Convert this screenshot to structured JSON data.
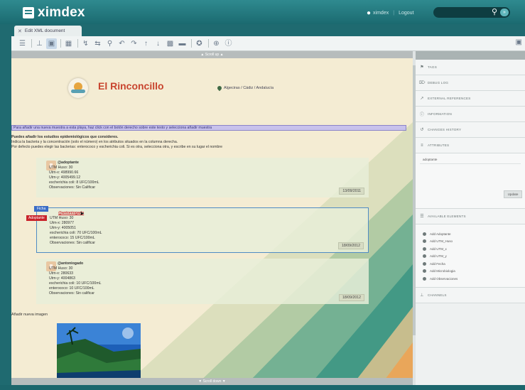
{
  "app": {
    "logo_text": "ximdex"
  },
  "header": {
    "user_label": "ximdex",
    "logout_label": "Logout",
    "search_placeholder": "",
    "search_go": "»"
  },
  "tabs": [
    {
      "label": "Edit XML document"
    }
  ],
  "toolbar": {
    "buttons": [
      "save-icon",
      "separator",
      "validate-icon",
      "image-icon",
      "separator",
      "table-icon",
      "separator",
      "spell-icon",
      "find-replace-icon",
      "zoom-icon",
      "undo-icon",
      "redo-icon",
      "link-icon",
      "anchor-icon",
      "view-icon",
      "preview-icon",
      "separator",
      "bookmark-icon",
      "separator",
      "help-icon"
    ],
    "right_icon": "monitor-icon"
  },
  "editor": {
    "scroll_top_label": "▲ Scroll up ▲",
    "scroll_bottom_label": "▼ Scroll down ▼",
    "site_title": "El Rinconcillo",
    "location": "Algeciras / Cádiz / Andalucía",
    "hint": "Para añadir una nueva muestra a esta playa, haz click con el botón derecho sobre este texto y selecciona añadir muestra",
    "intro": [
      "Puedes añadir los estudios epidemiológicos que consideres.",
      "Indica la bacteria y la concentración (solo el número) en los atributos situados en la columna derecha.",
      "Por defecto puedes elegir las bacterias: enterococo y escherichia coli. Si es otra, selecciona otra, y escribe en su lugar el nombre"
    ],
    "cards": [
      {
        "user": "@adoptante",
        "lines": [
          "UTM Huso: 30",
          "Utm-x: 498990.66",
          "Utm-y: 4005499.12",
          "escherichia coli: 8 UFC/100mL",
          "Observaciones: Sin Calificar"
        ],
        "date": "13/09/2011"
      },
      {
        "user": "@antoniogado",
        "lines": [
          "UTM Huso: 30",
          "Utm-x: 280977",
          "Utm-y: 4005051",
          "escherichia coli: 70 UFC/100mL",
          "enterococo: 15 UFC/100mL",
          "Observaciones: Sin calificar"
        ],
        "date": "18/09/2012"
      },
      {
        "user": "@antoniogado",
        "lines": [
          "UTM Huso: 30",
          "Utm-x: 280633",
          "Utm-y: 4004863",
          "escherichia coli: 10 UFC/100mL",
          "enterococo: 10 UFC/100mL",
          "Observaciones: Sin calificar"
        ],
        "date": "18/09/2012"
      }
    ],
    "selected_tags": {
      "blue": "Ficha",
      "red": "Adoptante"
    },
    "add_image_label": "Añadir nueva imagen"
  },
  "right_panel": {
    "sections": [
      {
        "icon": "tags-icon",
        "label": "TAGS"
      },
      {
        "icon": "link-icon",
        "label": "DEBUG LOG"
      },
      {
        "icon": "ref-icon",
        "label": "EXTERNAL REFERENCES"
      },
      {
        "icon": "info-icon",
        "label": "INFORMATION"
      },
      {
        "icon": "history-icon",
        "label": "CHANGES HISTORY"
      },
      {
        "icon": "attr-icon",
        "label": "ATTRIBUTES"
      }
    ],
    "attribute_value": "adoptante",
    "update_label": "Update",
    "available_label": "AVAILABLE ELEMENTS",
    "available_items": [
      "Add Adoptante",
      "Add UTM_Huso",
      "Add UTM_x",
      "Add UTM_y",
      "Add Fecha",
      "Add Microbiologia",
      "Add Observaciones"
    ],
    "channels_label": "CHANNELS"
  }
}
